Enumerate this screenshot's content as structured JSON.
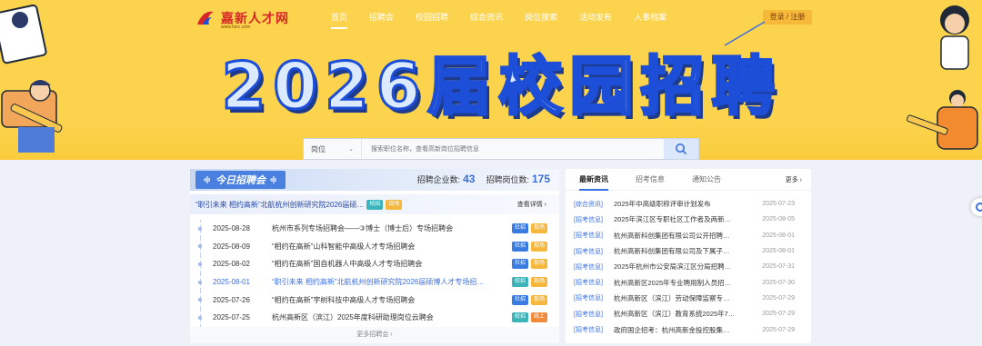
{
  "logo": {
    "name": "嘉新人才网",
    "sub": "www.hzrc.com"
  },
  "nav": [
    {
      "label": "首页",
      "active": true
    },
    {
      "label": "招聘会",
      "active": false
    },
    {
      "label": "校园招聘",
      "active": false
    },
    {
      "label": "综合资讯",
      "active": false
    },
    {
      "label": "岗位搜索",
      "active": false
    },
    {
      "label": "活动发布",
      "active": false
    },
    {
      "label": "人事档案",
      "active": false
    }
  ],
  "login_label": "登录 / 注册",
  "banner_title": "2026届校园招聘",
  "search": {
    "select": "岗位",
    "placeholder": "搜索职位名称，查看高新岗位招聘信息"
  },
  "fairs": {
    "title": "今日招聘会",
    "companies_label": "招聘企业数:",
    "companies": "43",
    "positions_label": "招聘岗位数:",
    "positions": "175",
    "feature": {
      "title": "“职引未来 相约高新”北航杭州创新研究院2026届硕…",
      "tags": [
        {
          "label": "校招",
          "type": "school"
        },
        {
          "label": "现场",
          "type": "site"
        }
      ],
      "more": "查看详情 ›"
    },
    "rows": [
      {
        "date": "2025-08-28",
        "name": "杭州市系列专场招聘会——③博士（博士后）专场招聘会",
        "tags": [
          {
            "label": "社招",
            "type": "society"
          },
          {
            "label": "现场",
            "type": "site"
          }
        ],
        "hl": false
      },
      {
        "date": "2025-08-09",
        "name": "“相约在高新”山科智能中高级人才专场招聘会",
        "tags": [
          {
            "label": "社招",
            "type": "society"
          },
          {
            "label": "现场",
            "type": "site"
          }
        ],
        "hl": false
      },
      {
        "date": "2025-08-02",
        "name": "“相约在高新”国自机器人中高级人才专场招聘会",
        "tags": [
          {
            "label": "社招",
            "type": "society"
          },
          {
            "label": "现场",
            "type": "site"
          }
        ],
        "hl": false
      },
      {
        "date": "2025-08-01",
        "name": "“职引未来 相约高新”北航杭州创新研究院2026届硕博人才专场招…",
        "tags": [
          {
            "label": "校招",
            "type": "school"
          },
          {
            "label": "现场",
            "type": "site"
          }
        ],
        "hl": true
      },
      {
        "date": "2025-07-26",
        "name": "“相约在高新”宇树科技中高级人才专场招聘会",
        "tags": [
          {
            "label": "社招",
            "type": "society"
          },
          {
            "label": "现场",
            "type": "site"
          }
        ],
        "hl": false
      },
      {
        "date": "2025-07-25",
        "name": "杭州高新区（滨江）2025年度科研助理岗位云聘会",
        "tags": [
          {
            "label": "校招",
            "type": "school"
          },
          {
            "label": "线上",
            "type": "online"
          }
        ],
        "hl": false
      }
    ],
    "more": "更多招聘会 ›"
  },
  "news": {
    "tabs": [
      {
        "label": "最新资讯",
        "active": true
      },
      {
        "label": "招考信息",
        "active": false
      },
      {
        "label": "通知公告",
        "active": false
      }
    ],
    "more": "更多 ›",
    "items": [
      {
        "cat": "[综合资讯]",
        "title": "2025年中高级职称评审计划发布",
        "date": "2025-07-23"
      },
      {
        "cat": "[招考信息]",
        "title": "2025年滨江区专职社区工作者及两新…",
        "date": "2025-08-05"
      },
      {
        "cat": "[招考信息]",
        "title": "杭州高新科创集团有限公司公开招聘…",
        "date": "2025-08-01"
      },
      {
        "cat": "[招考信息]",
        "title": "杭州高新科创集团有限公司及下属子…",
        "date": "2025-08-01"
      },
      {
        "cat": "[招考信息]",
        "title": "2025年杭州市公安局滨江区分局招聘…",
        "date": "2025-07-31"
      },
      {
        "cat": "[招考信息]",
        "title": "杭州高新区2025年专业聘用制人员招…",
        "date": "2025-07-30"
      },
      {
        "cat": "[招考信息]",
        "title": "杭州高新区（滨江）劳动保障监察专…",
        "date": "2025-07-29"
      },
      {
        "cat": "[招考信息]",
        "title": "杭州高新区（滨江）教育系统2025年7…",
        "date": "2025-07-29"
      },
      {
        "cat": "[招考信息]",
        "title": "政府国企招考：杭州高新金投控股集…",
        "date": "2025-07-29"
      }
    ]
  }
}
